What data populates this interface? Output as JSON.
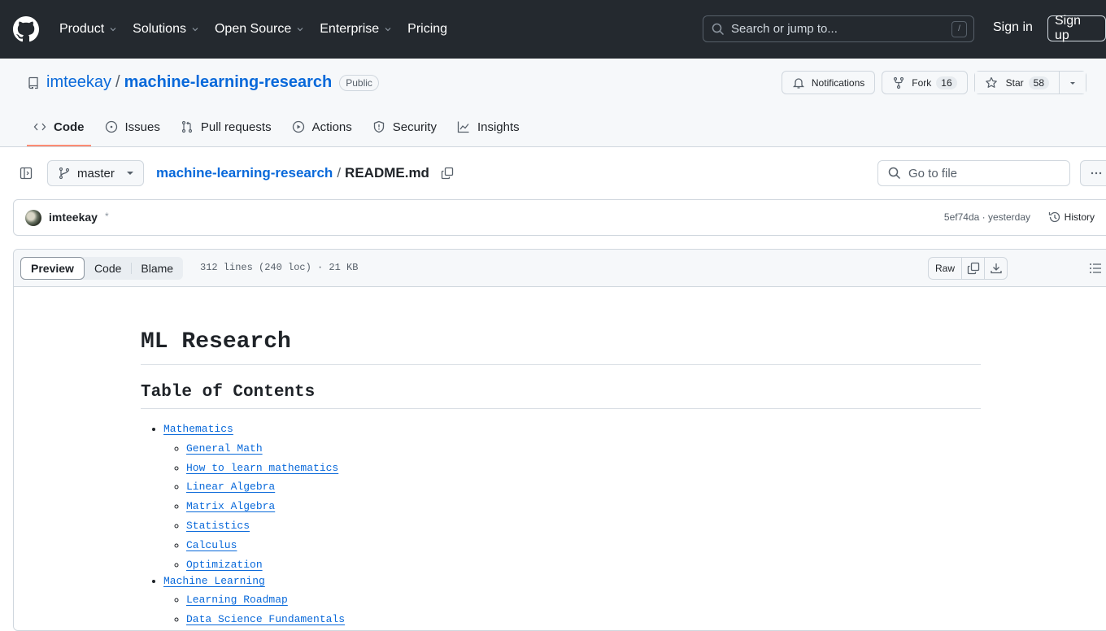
{
  "header": {
    "nav": [
      {
        "label": "Product",
        "has_menu": true
      },
      {
        "label": "Solutions",
        "has_menu": true
      },
      {
        "label": "Open Source",
        "has_menu": true
      },
      {
        "label": "Enterprise",
        "has_menu": true
      },
      {
        "label": "Pricing",
        "has_menu": false
      }
    ],
    "search_placeholder": "Search or jump to...",
    "search_shortcut": "/",
    "sign_in": "Sign in",
    "sign_up": "Sign up"
  },
  "repo": {
    "owner": "imteekay",
    "separator": "/",
    "name": "machine-learning-research",
    "visibility": "Public",
    "notifications_label": "Notifications",
    "fork_label": "Fork",
    "fork_count": "16",
    "star_label": "Star",
    "star_count": "58",
    "tabs": [
      {
        "label": "Code",
        "icon": "code-icon",
        "active": true
      },
      {
        "label": "Issues",
        "icon": "issue-icon",
        "active": false
      },
      {
        "label": "Pull requests",
        "icon": "pull-request-icon",
        "active": false
      },
      {
        "label": "Actions",
        "icon": "play-icon",
        "active": false
      },
      {
        "label": "Security",
        "icon": "shield-icon",
        "active": false
      },
      {
        "label": "Insights",
        "icon": "graph-icon",
        "active": false
      }
    ]
  },
  "file_nav": {
    "branch": "master",
    "path_root": "machine-learning-research",
    "path_sep": "/",
    "file_name": "README.md",
    "goto_placeholder": "Go to file"
  },
  "commit": {
    "author": "imteekay",
    "marker": "*",
    "sha": "5ef74da",
    "time": "yesterday",
    "meta": "5ef74da · yesterday",
    "history_label": "History"
  },
  "file": {
    "view_tabs": [
      "Preview",
      "Code",
      "Blame"
    ],
    "active_view": "Preview",
    "info": "312 lines (240 loc) · 21 KB",
    "raw_label": "Raw"
  },
  "readme": {
    "title": "ML Research",
    "toc_heading": "Table of Contents",
    "toc": [
      {
        "label": "Mathematics",
        "children": [
          "General Math",
          "How to learn mathematics",
          "Linear Algebra",
          "Matrix Algebra",
          "Statistics",
          "Calculus",
          "Optimization"
        ]
      },
      {
        "label": "Machine Learning",
        "children": [
          "Learning Roadmap",
          "Data Science Fundamentals"
        ]
      }
    ]
  }
}
